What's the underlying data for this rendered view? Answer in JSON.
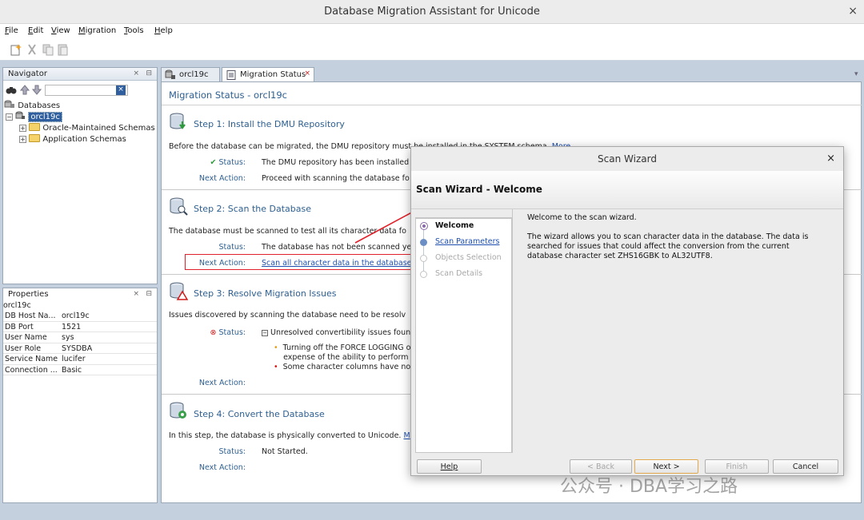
{
  "window": {
    "title": "Database Migration Assistant for Unicode",
    "close": "×"
  },
  "menu": [
    "File",
    "Edit",
    "View",
    "Migration",
    "Tools",
    "Help"
  ],
  "navigator": {
    "title": "Navigator",
    "root": "Databases",
    "connection": "orcl19c",
    "children": [
      "Oracle-Maintained Schemas",
      "Application Schemas"
    ]
  },
  "properties": {
    "title": "Properties",
    "object": "orcl19c",
    "rows": [
      {
        "key": "DB Host Na...",
        "value": "orcl19c"
      },
      {
        "key": "DB Port",
        "value": "1521"
      },
      {
        "key": "User Name",
        "value": "sys"
      },
      {
        "key": "User Role",
        "value": "SYSDBA"
      },
      {
        "key": "Service Name",
        "value": "lucifer"
      },
      {
        "key": "Connection ...",
        "value": "Basic"
      }
    ]
  },
  "tabs": [
    "orcl19c",
    "Migration Status"
  ],
  "main": {
    "title": "Migration Status - orcl19c",
    "status_label": "Status:",
    "next_action_label": "Next Action:",
    "step1": {
      "title": "Step 1: Install the DMU Repository",
      "desc": "Before the database can be migrated, the DMU repository must be installed in the SYSTEM schema.",
      "more": "More...",
      "status": "The DMU repository has been installed",
      "next": "Proceed with scanning the database fo"
    },
    "step2": {
      "title": "Step 2: Scan the Database",
      "desc": "The database must be scanned to test all its character data fo",
      "status": "The database has not been scanned ye",
      "next": "Scan all character data in the database"
    },
    "step3": {
      "title": "Step 3: Resolve Migration Issues",
      "desc": "Issues discovered by scanning the database need to be resolv",
      "status": "Unresolved convertibility issues foun",
      "bullet1a": "Turning off the FORCE LOGGING o",
      "bullet1b": "expense of the ability to perform",
      "bullet2": "Some character columns have no",
      "next": ""
    },
    "step4": {
      "title": "Step 4: Convert the Database",
      "desc": "In this step, the database is physically converted to Unicode.",
      "more": "M",
      "status": "Not Started."
    }
  },
  "dialog": {
    "title": "Scan Wizard",
    "header": "Scan Wizard - Welcome",
    "steps": [
      "Welcome",
      "Scan Parameters",
      "Objects Selection",
      "Scan Details"
    ],
    "intro": "Welcome to the scan wizard.",
    "body1": "The wizard allows you to scan character data in the database. The data is",
    "body2": "searched for issues that could affect the conversion from the current",
    "body3": "database character set ZHS16GBK to AL32UTF8.",
    "buttons": {
      "help": "Help",
      "back": "< Back",
      "next": "Next >",
      "finish": "Finish",
      "cancel": "Cancel"
    }
  },
  "watermark": "公众号 · DBA学习之路",
  "colors": {
    "accent": "#2e5f91",
    "annotation": "#e0202a",
    "link": "#1f4fae"
  }
}
